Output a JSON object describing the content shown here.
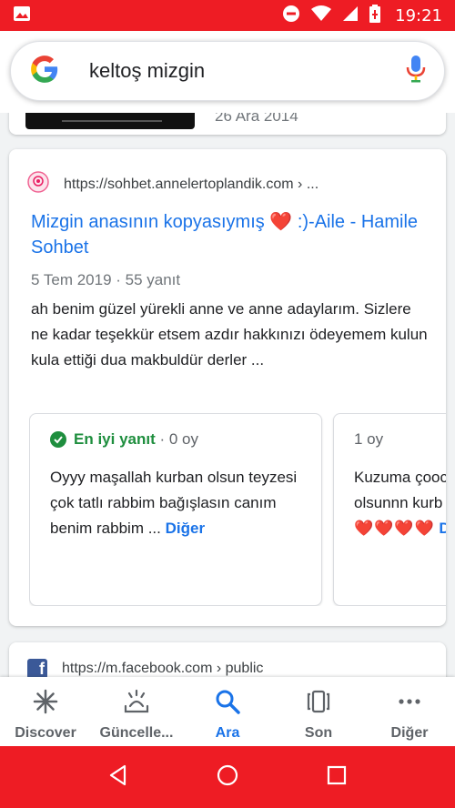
{
  "status_bar": {
    "time": "19:21",
    "icons": [
      "image-icon",
      "do-not-disturb-icon",
      "wifi-icon",
      "signal-icon",
      "battery-icon"
    ]
  },
  "search": {
    "query": "keltoş mizgin",
    "icons": [
      "google-logo",
      "mic-icon"
    ]
  },
  "previous_result": {
    "date": "26 Ara 2014"
  },
  "result": {
    "site_url": "https://sohbet.annelertoplandik.com › ...",
    "title_part1": "Mizgin anasının kopyasıymış",
    "title_heart": "❤️",
    "title_part2": ":)-Aile - Hamile Sohbet",
    "meta": "5 Tem 2019 · 55 yanıt",
    "snippet": "ah benim güzel yürekli anne ve anne adaylarım. Sizlere ne kadar teşekkür etsem azdır hakkınızı ödeyemem kulun kula ettiği dua makbuldür derler ...",
    "answers": [
      {
        "badge": "En iyi yanıt",
        "votes": "· 0 oy",
        "text": "Oyyy maşallah kurban olsun teyzesi çok tatlı rabbim bağışlasın canım benim rabbim ...",
        "more": "Diğer"
      },
      {
        "votes": "1 oy",
        "text_line1": "Kuzuma çooc",
        "text_line2": "olsunnn kurb",
        "hearts": "❤️❤️❤️❤️",
        "more": "D"
      }
    ]
  },
  "next_result": {
    "site_url": "https://m.facebook.com › public"
  },
  "bottom_nav": [
    {
      "label": "Discover",
      "icon": "asterisk-icon",
      "active": false
    },
    {
      "label": "Güncelle...",
      "icon": "updates-icon",
      "active": false
    },
    {
      "label": "Ara",
      "icon": "search-icon",
      "active": true
    },
    {
      "label": "Son",
      "icon": "recent-tabs-icon",
      "active": false
    },
    {
      "label": "Diğer",
      "icon": "more-icon",
      "active": false
    }
  ],
  "system_nav": [
    "back-icon",
    "home-icon",
    "recents-icon"
  ],
  "colors": {
    "status_bar": "#ee1c24",
    "link": "#1a73e8",
    "best_answer": "#1e8e3e"
  }
}
